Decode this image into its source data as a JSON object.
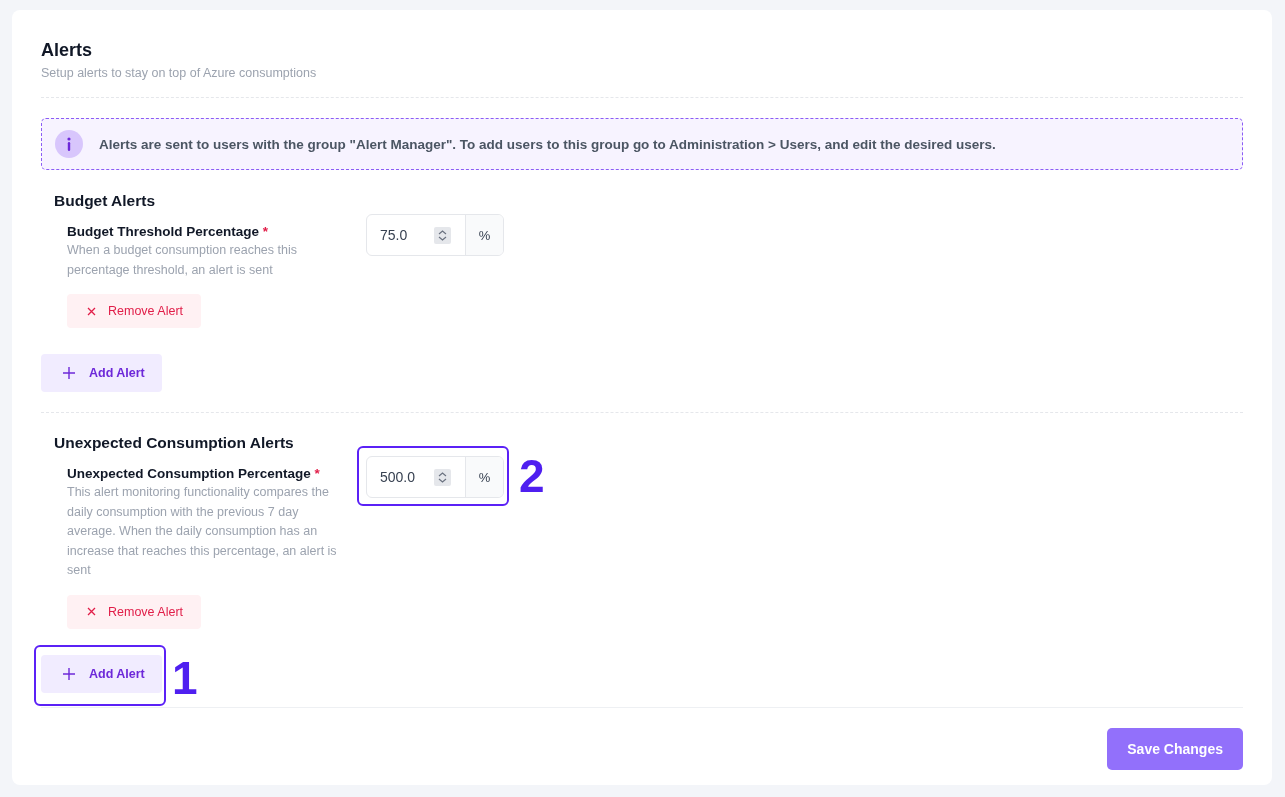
{
  "header": {
    "title": "Alerts",
    "subtitle": "Setup alerts to stay on top of Azure consumptions"
  },
  "info": {
    "text": "Alerts are sent to users with the group \"Alert Manager\". To add users to this group go to Administration > Users, and edit the desired users."
  },
  "sections": [
    {
      "title": "Budget Alerts",
      "alerts": [
        {
          "label": "Budget Threshold Percentage",
          "required_mark": "*",
          "description": "When a budget consumption reaches this percentage threshold, an alert is sent",
          "value": "75.0",
          "unit": "%",
          "remove_button": "Remove Alert"
        }
      ],
      "add_button": {
        "label": "Add Alert"
      }
    },
    {
      "title": "Unexpected Consumption Alerts",
      "alerts": [
        {
          "label": "Unexpected Consumption Percentage",
          "required_mark": "*",
          "description": "This alert monitoring functionality compares the daily consumption with the previous 7 day average. When the daily consumption has an increase that reaches this percentage, an alert is sent",
          "value": "500.0",
          "unit": "%",
          "remove_button": "Remove Alert",
          "callout": "2"
        }
      ],
      "add_button": {
        "label": "Add Alert",
        "callout": "1"
      }
    }
  ],
  "save_button": "Save Changes"
}
